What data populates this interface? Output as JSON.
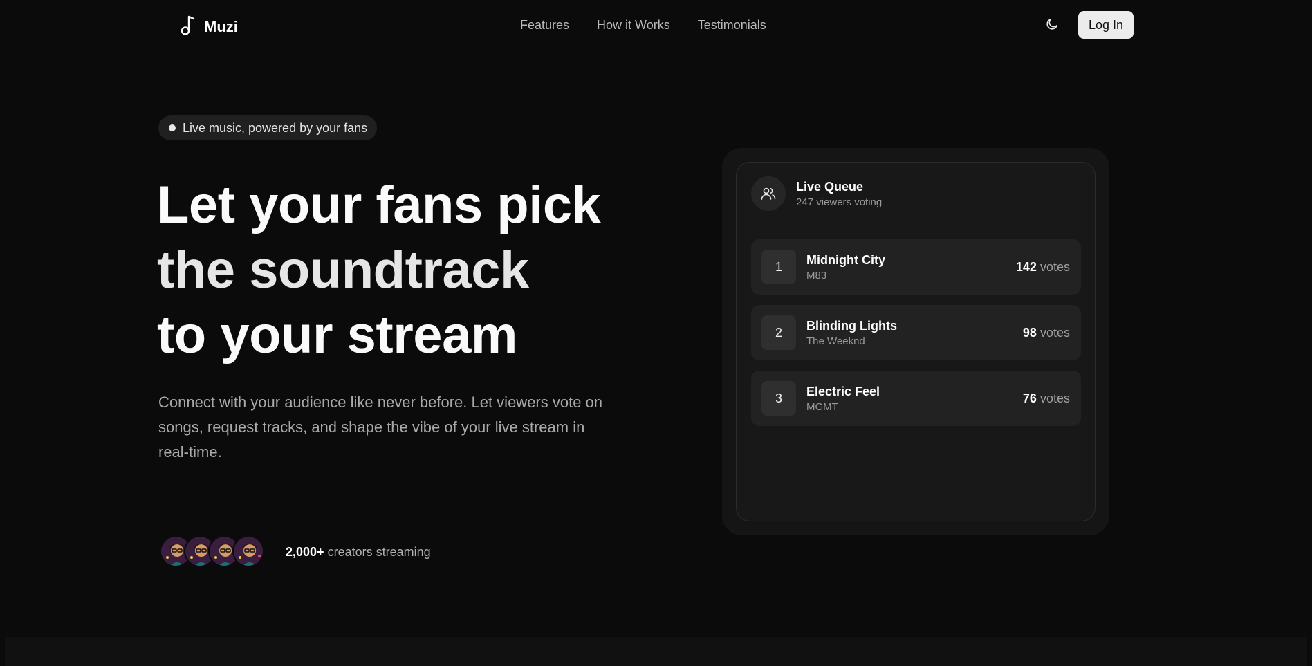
{
  "nav": {
    "brand": "Muzi",
    "links": [
      "Features",
      "How it Works",
      "Testimonials"
    ],
    "login_label": "Log In",
    "icons": {
      "logo": "music-note-icon",
      "theme": "moon-icon"
    }
  },
  "hero": {
    "badge": "Live music, powered by your fans",
    "headline_lines": [
      "Let your fans pick",
      "the soundtrack",
      "to your stream"
    ],
    "subtext": "Connect with your audience like never before. Let viewers vote on songs, request tracks, and shape the vibe of your live stream in real-time.",
    "social_count": "2,000+",
    "social_text": "creators streaming"
  },
  "queue": {
    "title": "Live Queue",
    "subtitle": "247 viewers voting",
    "vote_word": "votes",
    "items": [
      {
        "rank": "1",
        "title": "Midnight City",
        "artist": "M83",
        "votes": "142"
      },
      {
        "rank": "2",
        "title": "Blinding Lights",
        "artist": "The Weeknd",
        "votes": "98"
      },
      {
        "rank": "3",
        "title": "Electric Feel",
        "artist": "MGMT",
        "votes": "76"
      }
    ]
  },
  "colors": {
    "background": "#0b0b0b",
    "card": "#181818",
    "accent": "#ececec"
  }
}
